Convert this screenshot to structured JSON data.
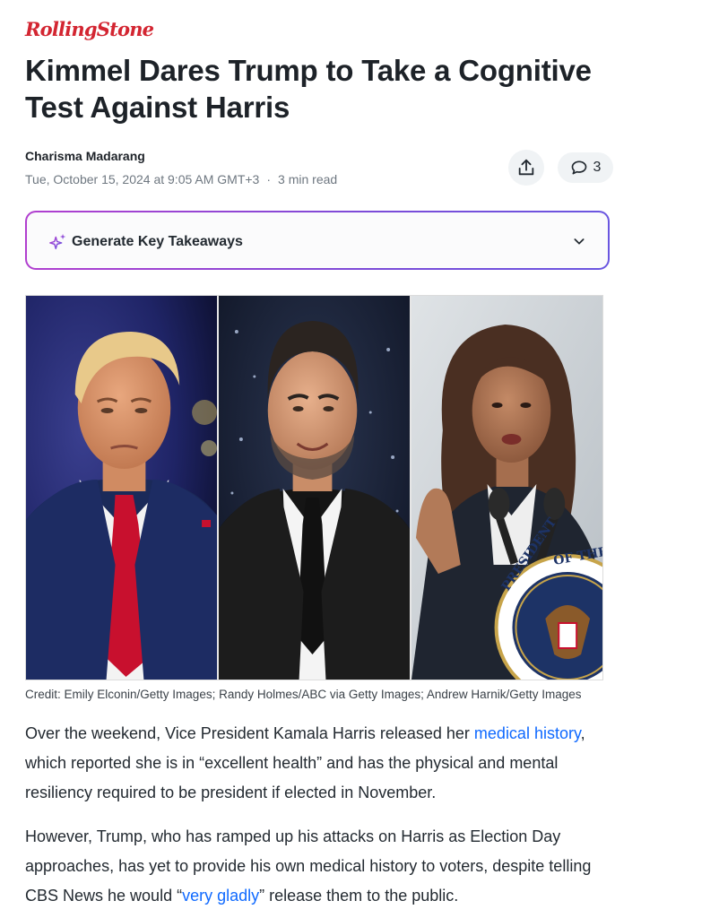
{
  "brand": {
    "logo_text": "RollingStone",
    "color": "#d32531"
  },
  "article": {
    "title": "Kimmel Dares Trump to Take a Cognitive Test Against Harris",
    "author": "Charisma Madarang",
    "date": "Tue, October 15, 2024 at 9:05 AM GMT+3",
    "separator": "·",
    "read_time": "3 min read"
  },
  "actions": {
    "share_icon": "share-icon",
    "comment_icon": "comment-icon",
    "comment_count": "3"
  },
  "takeaways": {
    "label": "Generate Key Takeaways",
    "icon": "sparkle-icon",
    "gradient": [
      "#b13fcf",
      "#6a56e0"
    ]
  },
  "image": {
    "panels": [
      "Donald Trump",
      "Jimmy Kimmel",
      "Kamala Harris"
    ],
    "seal_text": "PRESIDENT OF THE U",
    "credit": "Credit: Emily Elconin/Getty Images; Randy Holmes/ABC via Getty Images; Andrew Harnik/Getty Images"
  },
  "body": {
    "p1_before": "Over the weekend, Vice President Kamala Harris released her ",
    "p1_link": "medical history",
    "p1_after": ", which reported she is in “excellent health” and has the physical and mental resiliency required to be president if elected in November.",
    "p2_before": "However, Trump, who has ramped up his attacks on Harris as Election Day approaches, has yet to provide his own medical history to voters, despite telling CBS News he would “",
    "p2_link": "very gladly",
    "p2_after": "” release them to the public.",
    "link_color": "#0f69ff"
  }
}
